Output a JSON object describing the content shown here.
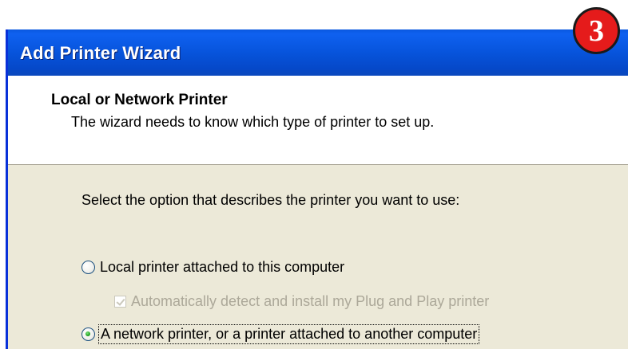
{
  "window": {
    "title": "Add Printer Wizard"
  },
  "header": {
    "title": "Local or Network Printer",
    "subtitle": "The wizard needs to know which type of printer to set up."
  },
  "body": {
    "prompt": "Select the option that describes the printer you want to use:",
    "options": [
      {
        "label": "Local printer attached to this computer",
        "selected": false
      },
      {
        "label": "Automatically detect and install my Plug and Play printer",
        "checked": true,
        "disabled": true
      },
      {
        "label": "A network printer, or a printer attached to another computer",
        "selected": true
      }
    ]
  },
  "badge": {
    "step": "3",
    "color": "#e51b1b"
  },
  "colors": {
    "titlebar": "#0754dc",
    "dialog_bg": "#ece9d8",
    "header_bg": "#ffffff"
  }
}
